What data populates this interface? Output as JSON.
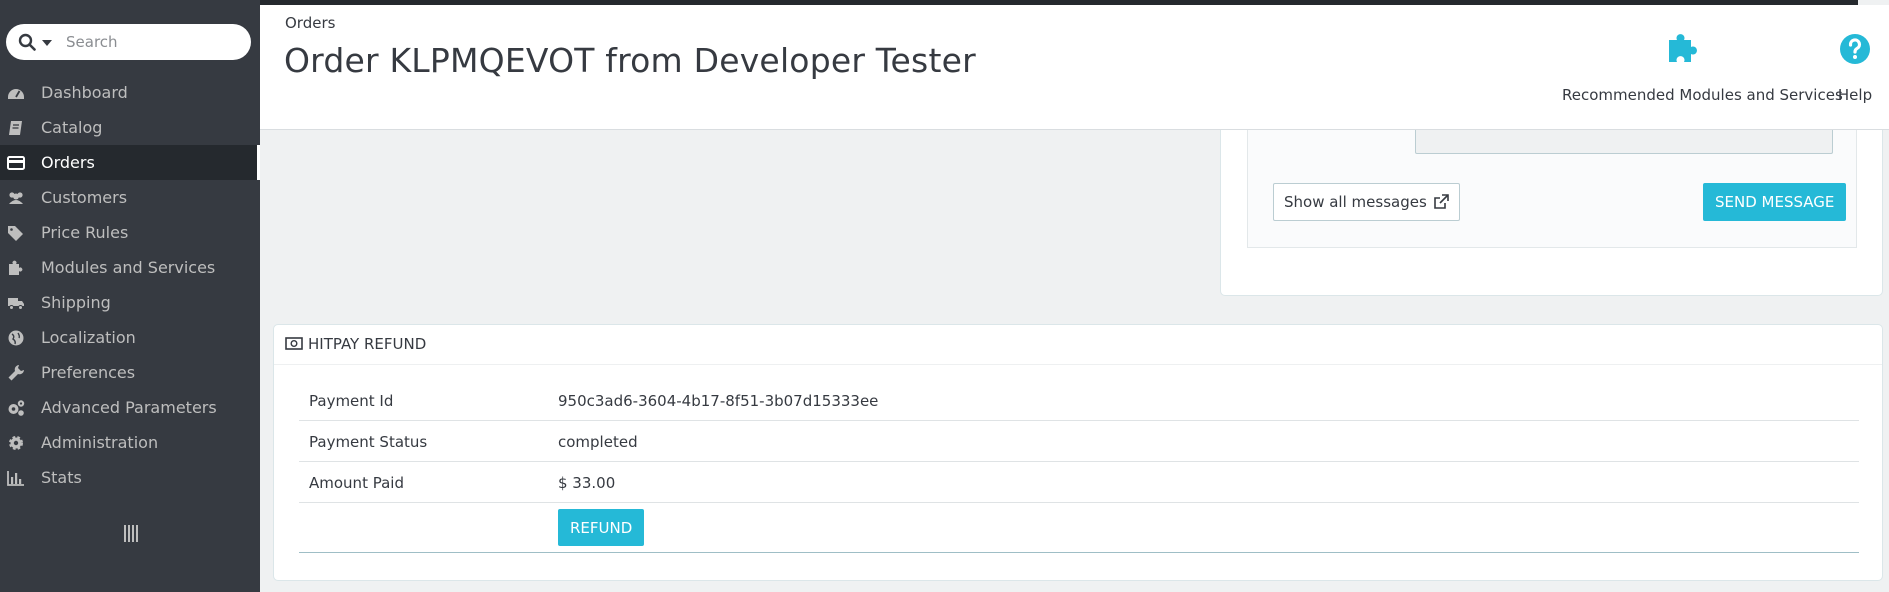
{
  "sidebar": {
    "search": {
      "placeholder": "Search"
    },
    "items": [
      {
        "label": "Dashboard",
        "icon": "dashboard-icon"
      },
      {
        "label": "Catalog",
        "icon": "catalog-icon"
      },
      {
        "label": "Orders",
        "icon": "orders-icon",
        "active": true
      },
      {
        "label": "Customers",
        "icon": "customers-icon"
      },
      {
        "label": "Price Rules",
        "icon": "price-tags-icon"
      },
      {
        "label": "Modules and Services",
        "icon": "puzzle-icon"
      },
      {
        "label": "Shipping",
        "icon": "truck-icon"
      },
      {
        "label": "Localization",
        "icon": "globe-icon"
      },
      {
        "label": "Preferences",
        "icon": "wrench-icon"
      },
      {
        "label": "Advanced Parameters",
        "icon": "cogs-icon"
      },
      {
        "label": "Administration",
        "icon": "gear-icon"
      },
      {
        "label": "Stats",
        "icon": "bar-chart-icon"
      }
    ]
  },
  "header": {
    "breadcrumb": "Orders",
    "title": "Order KLPMQEVOT from Developer Tester",
    "toolbar": {
      "recommended_label": "Recommended Modules and Services",
      "help_label": "Help"
    }
  },
  "messages": {
    "show_all_label": "Show all messages",
    "send_label": "SEND MESSAGE"
  },
  "hitpay": {
    "title": "HITPAY REFUND",
    "rows": [
      {
        "key": "Payment Id",
        "value": "950c3ad6-3604-4b17-8f51-3b07d15333ee"
      },
      {
        "key": "Payment Status",
        "value": "completed"
      },
      {
        "key": "Amount Paid",
        "value": "$ 33.00"
      }
    ],
    "refund_label": "REFUND"
  },
  "colors": {
    "sidebar_bg": "#363a41",
    "accent": "#25b9d7",
    "page_bg": "#eff1f2"
  }
}
